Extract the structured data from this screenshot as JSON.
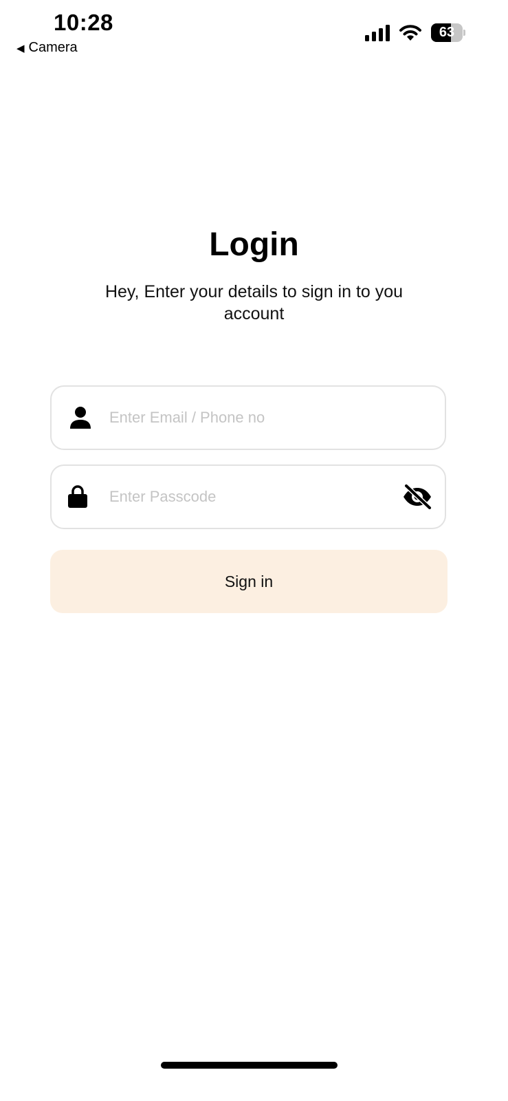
{
  "status_bar": {
    "time": "10:28",
    "back_label": "Camera",
    "battery_level": "63"
  },
  "login": {
    "title": "Login",
    "subtitle": "Hey, Enter your details to sign in to you account",
    "email_placeholder": "Enter Email / Phone no",
    "passcode_placeholder": "Enter Passcode",
    "sign_in_label": "Sign in"
  },
  "colors": {
    "button_bg": "#fcefe1",
    "field_border": "#e2e2e2",
    "placeholder": "#c4c4c4"
  },
  "icons": {
    "email_field": "person-icon",
    "passcode_field": "lock-icon",
    "passcode_toggle": "eye-off-icon"
  }
}
